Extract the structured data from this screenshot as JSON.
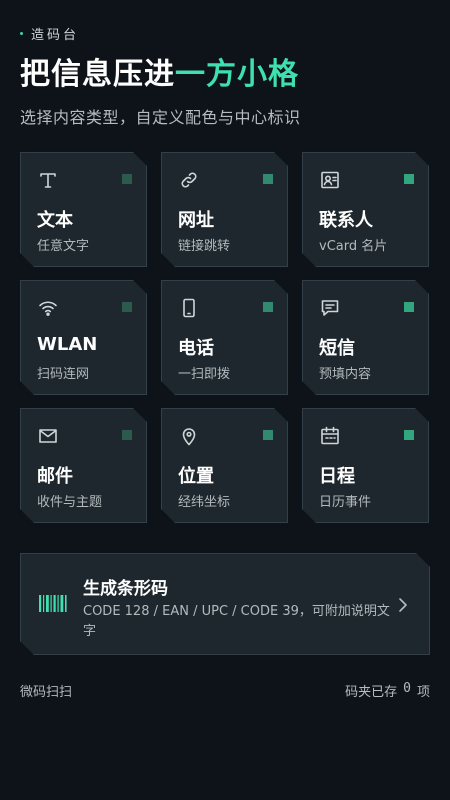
{
  "brand": "造码台",
  "title": {
    "main": "把信息压进",
    "accent": "一方小格"
  },
  "subtitle": "选择内容类型，自定义配色与中心标识",
  "cards": [
    {
      "key": "text",
      "icon": "text-icon",
      "name": "文本",
      "desc": "任意文字",
      "indicator_color": "#2c5a4d"
    },
    {
      "key": "url",
      "icon": "link-icon",
      "name": "网址",
      "desc": "链接跳转",
      "indicator_color": "#2f8a70"
    },
    {
      "key": "contact",
      "icon": "contact-card-icon",
      "name": "联系人",
      "desc": "vCard 名片",
      "indicator_color": "#33a57f"
    },
    {
      "key": "wlan",
      "icon": "wifi-icon",
      "name": "WLAN",
      "desc": "扫码连网",
      "indicator_color": "#2c5a4d"
    },
    {
      "key": "phone",
      "icon": "phone-icon",
      "name": "电话",
      "desc": "一扫即拨",
      "indicator_color": "#2f8a70"
    },
    {
      "key": "sms",
      "icon": "message-icon",
      "name": "短信",
      "desc": "预填内容",
      "indicator_color": "#33a57f"
    },
    {
      "key": "email",
      "icon": "mail-icon",
      "name": "邮件",
      "desc": "收件与主题",
      "indicator_color": "#2c5a4d"
    },
    {
      "key": "location",
      "icon": "location-pin-icon",
      "name": "位置",
      "desc": "经纬坐标",
      "indicator_color": "#2f8a70"
    },
    {
      "key": "calendar",
      "icon": "calendar-icon",
      "name": "日程",
      "desc": "日历事件",
      "indicator_color": "#33a57f"
    }
  ],
  "barcode": {
    "icon": "barcode-icon",
    "title": "生成条形码",
    "desc": "CODE 128 / EAN / UPC / CODE 39，可附加说明文字"
  },
  "footer": {
    "left": "微码扫扫",
    "right_prefix": "码夹已存",
    "count": "0",
    "right_suffix": "项"
  },
  "colors": {
    "accent": "#3fe0b0",
    "background": "#0d1318",
    "card": "#1e272d",
    "icon_stroke": "#cfd6d9"
  }
}
